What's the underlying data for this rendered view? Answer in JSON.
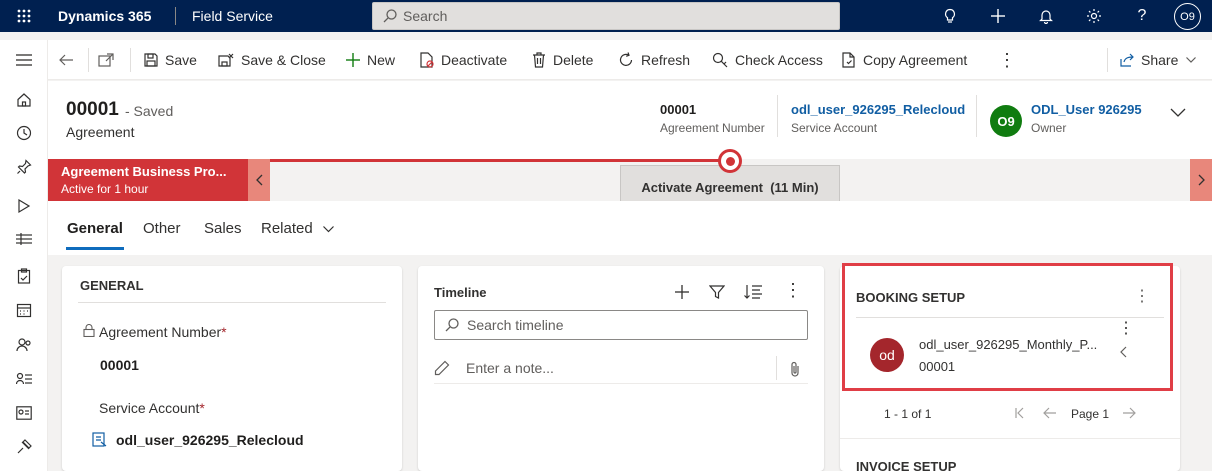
{
  "topbar": {
    "app_name": "Dynamics 365",
    "module": "Field Service",
    "search_placeholder": "Search",
    "user_initials": "O9"
  },
  "commands": {
    "save": "Save",
    "save_close": "Save & Close",
    "new": "New",
    "deactivate": "Deactivate",
    "delete": "Delete",
    "refresh": "Refresh",
    "check_access": "Check Access",
    "copy_agreement": "Copy Agreement",
    "share": "Share"
  },
  "header": {
    "title": "00001",
    "saved": "- Saved",
    "entity": "Agreement",
    "agreement_number_value": "00001",
    "agreement_number_label": "Agreement Number",
    "service_account_value": "odl_user_926295_Relecloud",
    "service_account_label": "Service Account",
    "owner_initials": "O9",
    "owner_value": "ODL_User 926295",
    "owner_label": "Owner"
  },
  "bpf": {
    "process_name": "Agreement Business Pro...",
    "active_for": "Active for 1 hour",
    "stage": "Activate Agreement",
    "stage_duration": "(11 Min)"
  },
  "tabs": [
    "General",
    "Other",
    "Sales",
    "Related"
  ],
  "general": {
    "title": "GENERAL",
    "agreement_number_label": "Agreement Number",
    "agreement_number_value": "00001",
    "service_account_label": "Service Account",
    "service_account_value": "odl_user_926295_Relecloud",
    "required_mark": "*"
  },
  "timeline": {
    "title": "Timeline",
    "search_placeholder": "Search timeline",
    "note_placeholder": "Enter a note..."
  },
  "booking_setup": {
    "title": "BOOKING SETUP",
    "record_initials": "od",
    "record_name": "odl_user_926295_Monthly_P...",
    "record_sub": "00001",
    "count": "1 - 1 of 1",
    "page": "Page 1"
  },
  "invoice_setup": {
    "title": "INVOICE SETUP"
  }
}
